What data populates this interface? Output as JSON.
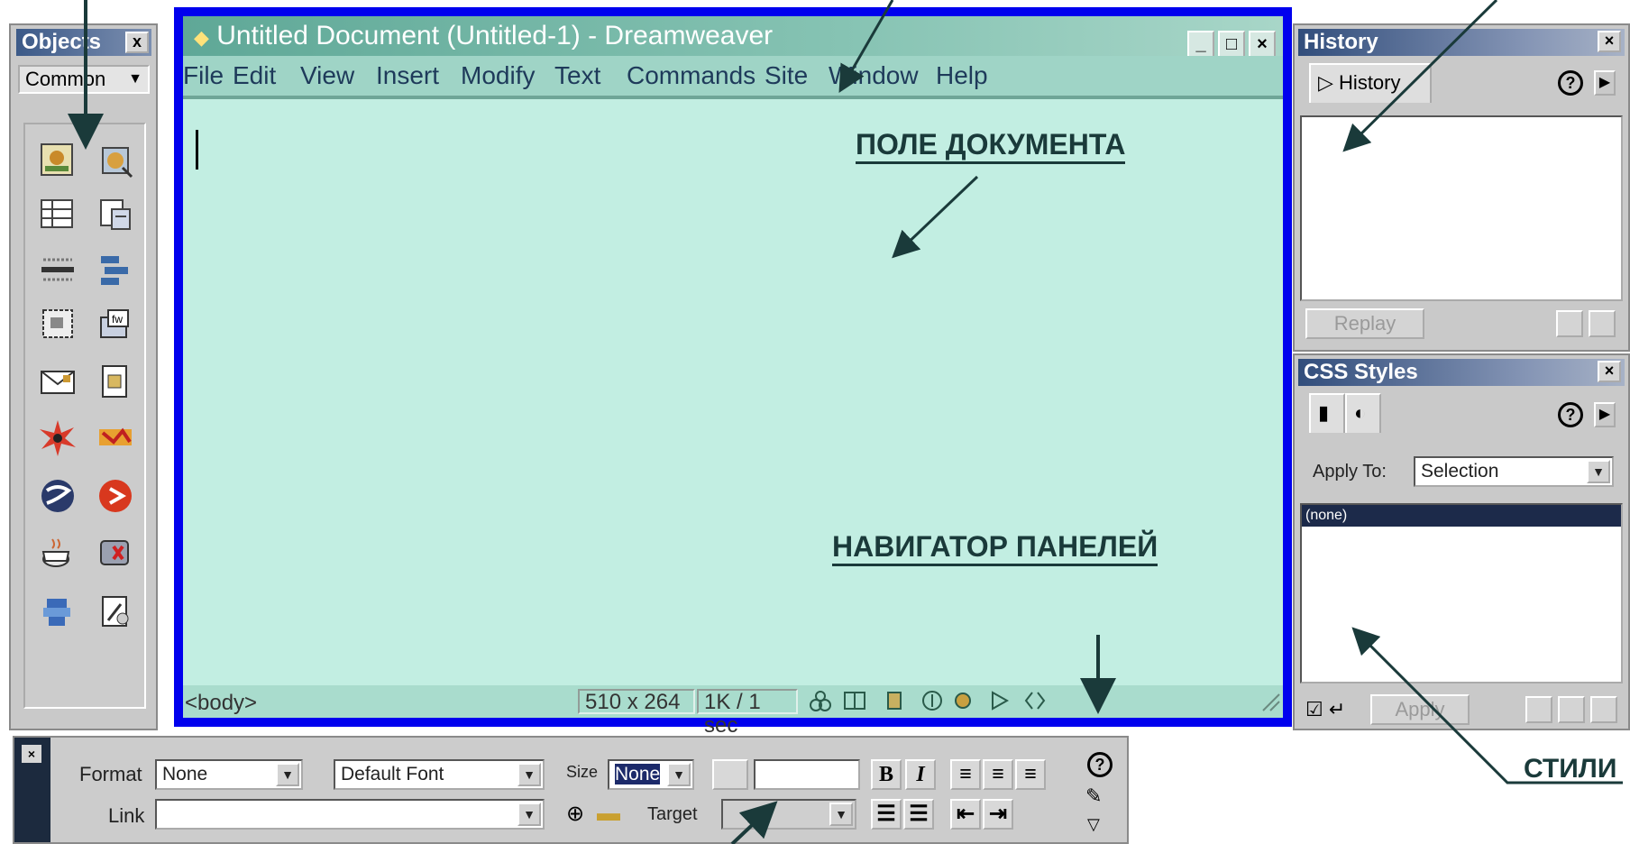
{
  "objects_panel": {
    "title": "Objects",
    "close": "x",
    "category": "Common",
    "icons": [
      "insert-image-icon",
      "insert-rollover-image-icon",
      "insert-table-icon",
      "insert-tabular-data-icon",
      "insert-horizontal-rule-icon",
      "insert-navigation-bar-icon",
      "insert-layer-icon",
      "insert-fireworks-html-icon",
      "insert-email-link-icon",
      "insert-named-anchor-icon",
      "insert-flash-icon",
      "insert-flash-text-icon",
      "insert-shockwave-icon",
      "insert-generator-icon",
      "insert-applet-icon",
      "insert-activex-icon",
      "insert-plugin-icon",
      "insert-server-side-include-icon"
    ]
  },
  "document_window": {
    "title": "Untitled Document (Untitled-1) - Dreamweaver",
    "menu": [
      "File",
      "Edit",
      "View",
      "Insert",
      "Modify",
      "Text",
      "Commands",
      "Site",
      "Window",
      "Help"
    ],
    "annotation_doc": "ПОЛЕ ДОКУМЕНТА",
    "annotation_nav": "НАВИГАТОР ПАНЕЛЕЙ",
    "status": {
      "tag": "<body>",
      "size": "510 x 264",
      "speed": "1K / 1 sec"
    }
  },
  "history_panel": {
    "title": "History",
    "tab": "History",
    "replay": "Replay"
  },
  "css_panel": {
    "title": "CSS Styles",
    "apply_to_label": "Apply To:",
    "apply_to_value": "Selection",
    "selected_style": "(none)",
    "apply_button": "Apply"
  },
  "properties_bar": {
    "format_label": "Format",
    "format_value": "None",
    "font_value": "Default Font",
    "size_label": "Size",
    "size_value": "None",
    "link_label": "Link",
    "target_label": "Target",
    "bold": "B",
    "italic": "I"
  },
  "annotation_styles": "СТИЛИ",
  "colors": {
    "doc_border": "#0000ee",
    "doc_bg": "#c2eee2",
    "panel_bg": "#c9c9c9",
    "titlebar": "#3c5a88"
  }
}
